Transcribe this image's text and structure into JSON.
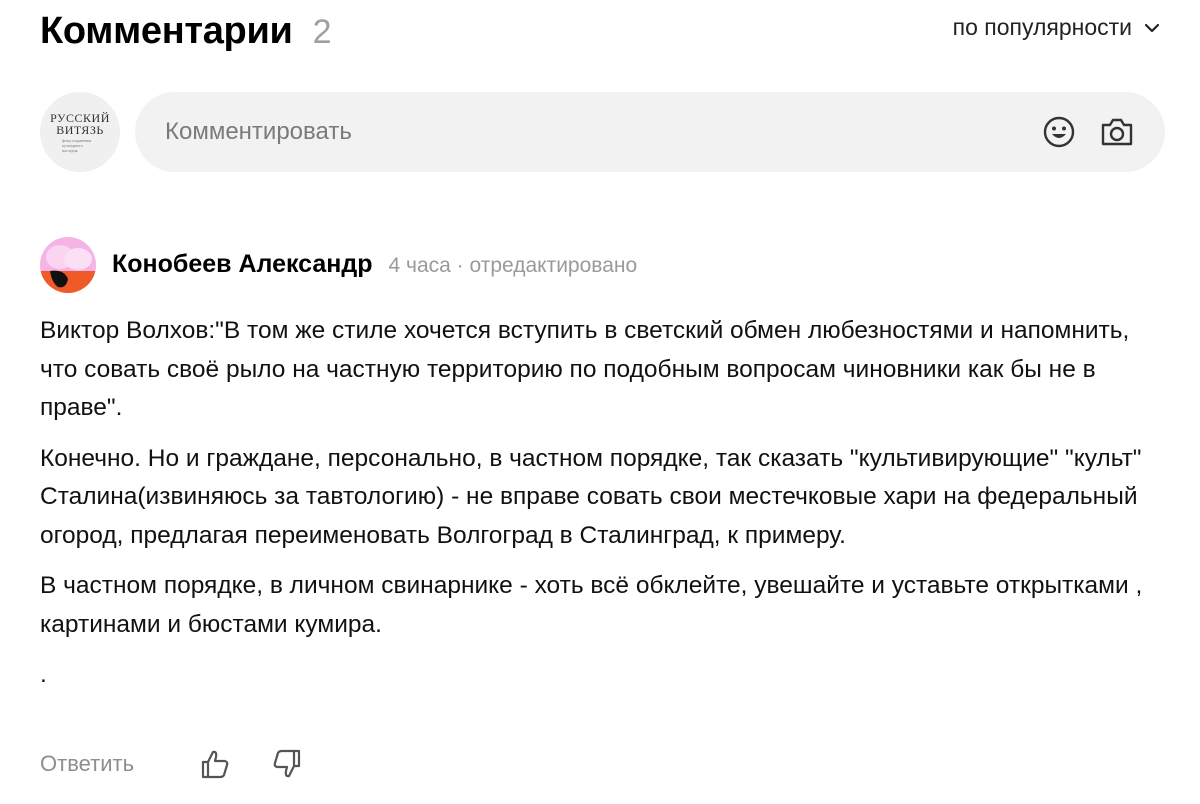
{
  "header": {
    "title": "Комментарии",
    "count": "2"
  },
  "sort": {
    "label": "по популярности",
    "icon": "chevron-down-icon"
  },
  "composer": {
    "avatar_line1": "РУССКИЙ",
    "avatar_line2": "ВИТЯЗЬ",
    "avatar_line3": "фонд сохранения культурного наследия",
    "placeholder": "Комментировать",
    "emoji_icon": "emoji-icon",
    "camera_icon": "camera-icon"
  },
  "comment": {
    "author": "Конобеев Александр",
    "meta": "4 часа · отредактировано",
    "paragraphs": [
      "Виктор Волхов:\"В том же стиле хочется вступить в светский обмен любезностями и напомнить, что совать своё рыло на частную территорию по подобным вопросам чиновники как бы не в праве\".",
      "Конечно. Но и граждане, персонально, в частном порядке, так сказать \"культивирующие\" \"культ\" Сталина(извиняюсь за тавтологию) - не вправе совать свои местечковые хари на федеральный огород, предлагая переименовать Волгоград в Сталинград, к примеру.",
      "В частном порядке, в личном свинарнике - хоть всё обклейте, увешайте и уставьте открытками , картинами и бюстами кумира.",
      "."
    ],
    "reply_label": "Ответить"
  },
  "colors": {
    "input_bg": "#f2f2f2",
    "muted": "#9a9a9a",
    "avatar_pink": "#f5b3e6",
    "avatar_orange": "#f05a28"
  }
}
